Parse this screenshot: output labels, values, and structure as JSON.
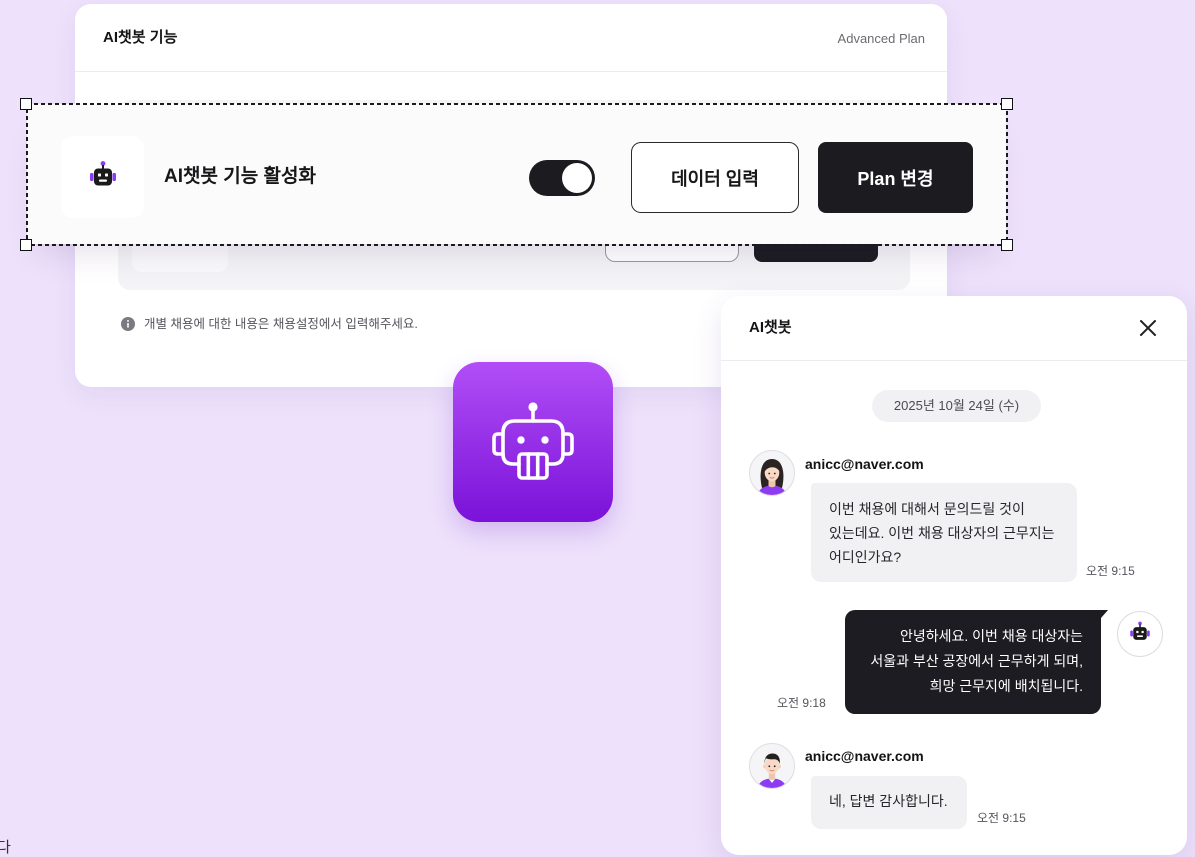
{
  "page": {
    "bottom_left_fragment": "다"
  },
  "settings_card": {
    "title": "AI챗봇 기능",
    "plan_label": "Advanced Plan",
    "info_icon": "info-icon",
    "info_text": "개별 채용에 대한 내용은 채용설정에서 입력해주세요."
  },
  "feature_row": {
    "icon": "robot-icon",
    "label": "AI챗봇 기능 활성화",
    "toggle": {
      "checked": true
    },
    "data_button_label": "데이터 입력",
    "plan_button_label": "Plan 변경"
  },
  "app_tile": {
    "icon": "robot-outline-icon"
  },
  "chat": {
    "title": "AI챗봇",
    "close_icon": "close-icon",
    "date_label": "2025년 10월 24일 (수)",
    "messages": [
      {
        "sender": "anicc@naver.com",
        "avatar": "woman-avatar",
        "lines": [
          "이번 채용에 대해서 문의드릴 것이",
          "있는데요. 이번 채용 대상자의 근무지는",
          "어디인가요?"
        ],
        "time": "오전 9:15"
      },
      {
        "avatar": "robot-icon",
        "lines": [
          "안녕하세요. 이번 채용 대상자는",
          "서울과 부산 공장에서 근무하게 되며,",
          "희망 근무지에 배치됩니다."
        ],
        "time": "오전 9:18"
      },
      {
        "sender": "anicc@naver.com",
        "avatar": "man-avatar",
        "lines": [
          "네, 답변 감사합니다."
        ],
        "time": "오전 9:15"
      }
    ]
  },
  "colors": {
    "background": "#ede1fb",
    "accent_purple": "#8b3cf0",
    "tile_gradient_top": "#b24ef7",
    "tile_gradient_bottom": "#7a12d8",
    "dark": "#1b1b20",
    "bubble_gray": "#f1f1f4"
  }
}
